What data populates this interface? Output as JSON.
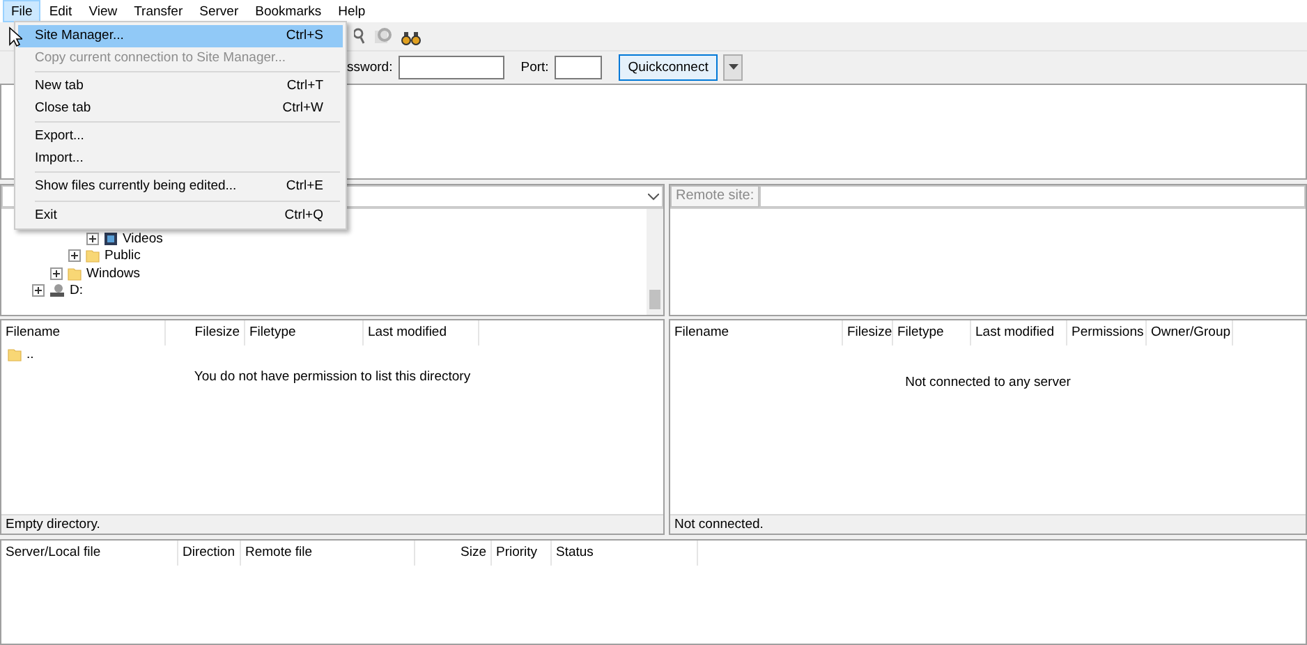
{
  "menu_bar": [
    {
      "label": "File",
      "selected": true
    },
    {
      "label": "Edit",
      "selected": false
    },
    {
      "label": "View",
      "selected": false
    },
    {
      "label": "Transfer",
      "selected": false
    },
    {
      "label": "Server",
      "selected": false
    },
    {
      "label": "Bookmarks",
      "selected": false
    },
    {
      "label": "Help",
      "selected": false
    }
  ],
  "file_menu": [
    {
      "kind": "item",
      "label": "Site Manager...",
      "shortcut": "Ctrl+S",
      "selected": true,
      "disabled": false
    },
    {
      "kind": "item",
      "label": "Copy current connection to Site Manager...",
      "selected": false,
      "disabled": true
    },
    {
      "kind": "separator"
    },
    {
      "kind": "item",
      "label": "New tab",
      "shortcut": "Ctrl+T",
      "selected": false,
      "disabled": false
    },
    {
      "kind": "item",
      "label": "Close tab",
      "shortcut": "Ctrl+W",
      "selected": false,
      "disabled": false
    },
    {
      "kind": "separator"
    },
    {
      "kind": "item",
      "label": "Export...",
      "selected": false,
      "disabled": false
    },
    {
      "kind": "item",
      "label": "Import...",
      "selected": false,
      "disabled": false
    },
    {
      "kind": "separator"
    },
    {
      "kind": "item",
      "label": "Show files currently being edited...",
      "shortcut": "Ctrl+E",
      "selected": false,
      "disabled": false
    },
    {
      "kind": "separator"
    },
    {
      "kind": "item",
      "label": "Exit",
      "shortcut": "Ctrl+Q",
      "selected": false,
      "disabled": false
    }
  ],
  "quickconnect": {
    "password_label": "ssword:",
    "port_label": "Port:",
    "button": "Quickconnect"
  },
  "local_site": {
    "tree": [
      {
        "children": [
          {
            "children": [
              {
                "children": [
                  {
                    "label": "Videos",
                    "kind": "video"
                  }
                ]
              },
              {
                "label": "Public",
                "kind": "folder"
              }
            ]
          },
          {
            "label": "Windows",
            "kind": "folder"
          }
        ]
      },
      {
        "label": "D:",
        "kind": "drive"
      }
    ],
    "columns": [
      "Filename",
      "Filesize",
      "Filetype",
      "Last modified"
    ],
    "rows": [
      {
        "name": "..",
        "kind": "folder"
      }
    ],
    "message": "You do not have permission to list this directory",
    "status": "Empty directory."
  },
  "remote_site": {
    "label": "Remote site:",
    "columns": [
      "Filename",
      "Filesize",
      "Filetype",
      "Last modified",
      "Permissions",
      "Owner/Group"
    ],
    "message": "Not connected to any server",
    "status": "Not connected."
  },
  "queue": {
    "columns": [
      "Server/Local file",
      "Direction",
      "Remote file",
      "Size",
      "Priority",
      "Status"
    ]
  }
}
